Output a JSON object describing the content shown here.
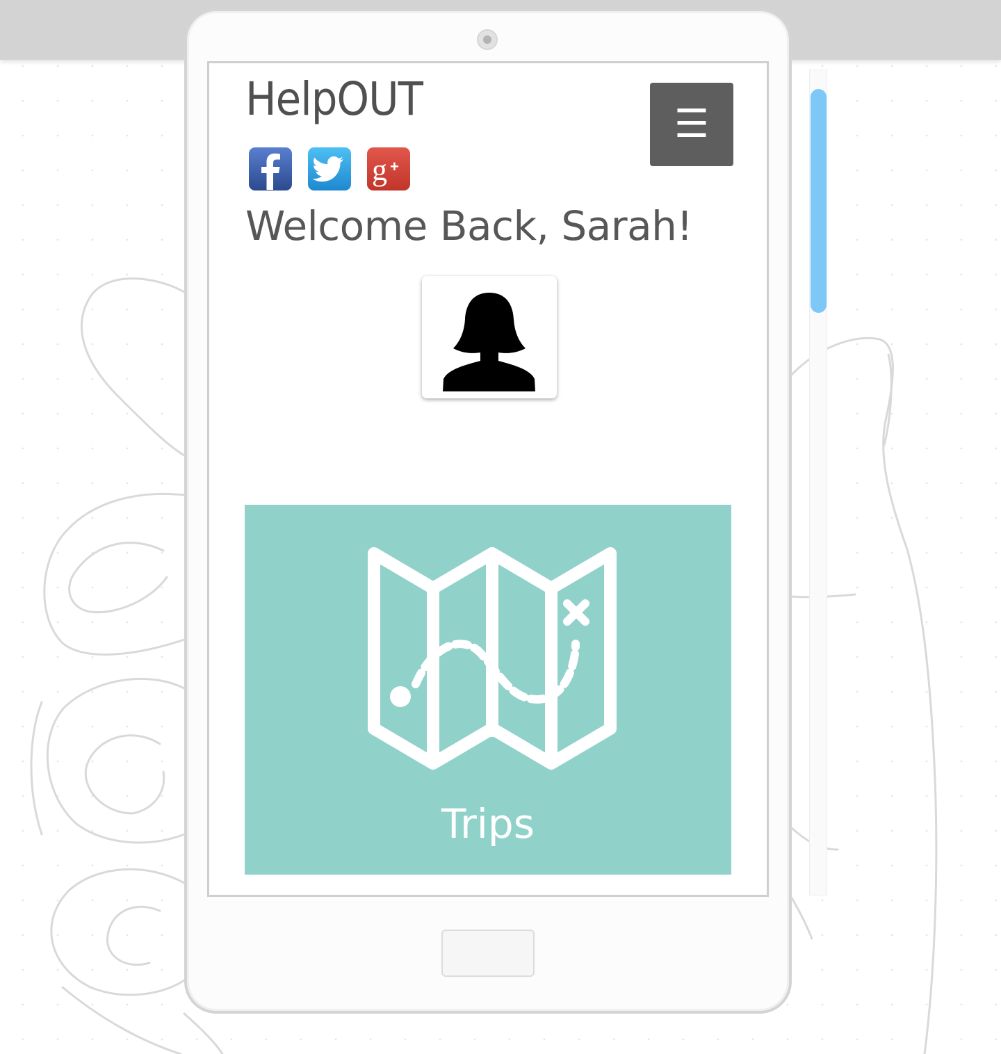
{
  "app": {
    "brand": "HelpOUT",
    "greeting": "Welcome Back, Sarah!",
    "menu_glyph": "☰"
  },
  "social": [
    {
      "name": "facebook",
      "glyph": "f",
      "color": "#3b5998"
    },
    {
      "name": "twitter",
      "color": "#2aa3e5"
    },
    {
      "name": "google-plus",
      "glyph": "g+",
      "color": "#d73d32"
    }
  ],
  "tiles": [
    {
      "label": "Trips",
      "icon": "treasure-map-icon",
      "color": "#90d1ca"
    }
  ],
  "avatar": {
    "icon": "female-user-silhouette-icon"
  },
  "scrollbar": {
    "thumb_color": "#7ec8f8",
    "position": 0
  }
}
